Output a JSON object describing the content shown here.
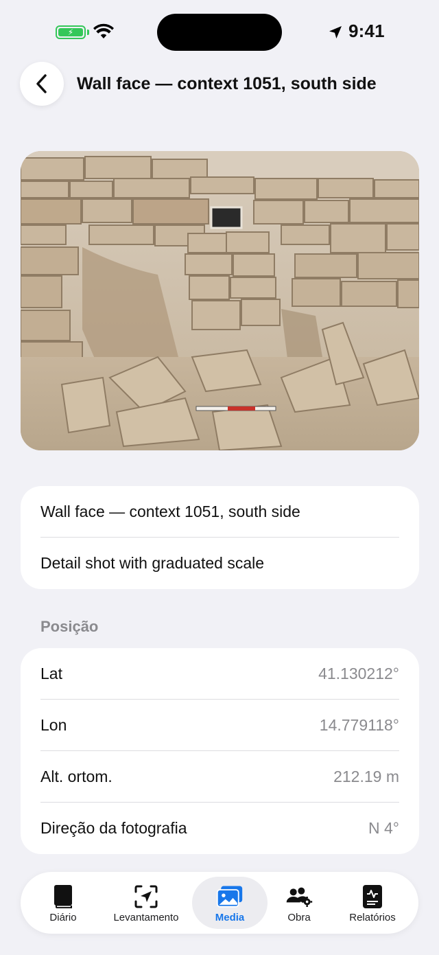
{
  "status_bar": {
    "time": "9:41",
    "battery_icon": "battery-charging-icon",
    "wifi_icon": "wifi-icon",
    "location_icon": "location-arrow-icon",
    "battery_color": "#34c759"
  },
  "header": {
    "title": "Wall face — context 1051, south side",
    "back_icon": "chevron-left-icon"
  },
  "photo": {
    "subject": "stone-wall-excavation-photo"
  },
  "caption_card": {
    "title": "Wall face — context 1051, south side",
    "description": "Detail shot with graduated scale"
  },
  "position": {
    "section_label": "Posição",
    "rows": [
      {
        "label": "Lat",
        "value": "41.130212°"
      },
      {
        "label": "Lon",
        "value": "14.779118°"
      },
      {
        "label": "Alt. ortom.",
        "value": "212.19 m"
      },
      {
        "label": "Direção da fotografia",
        "value": "N 4°"
      }
    ]
  },
  "tabbar": {
    "accent_color": "#1877ea",
    "tabs": [
      {
        "label": "Diário",
        "icon": "book-icon",
        "active": false
      },
      {
        "label": "Levantamento",
        "icon": "scan-location-icon",
        "active": false
      },
      {
        "label": "Media",
        "icon": "photos-icon",
        "active": true
      },
      {
        "label": "Obra",
        "icon": "people-gear-icon",
        "active": false
      },
      {
        "label": "Relatórios",
        "icon": "report-icon",
        "active": false
      }
    ]
  }
}
